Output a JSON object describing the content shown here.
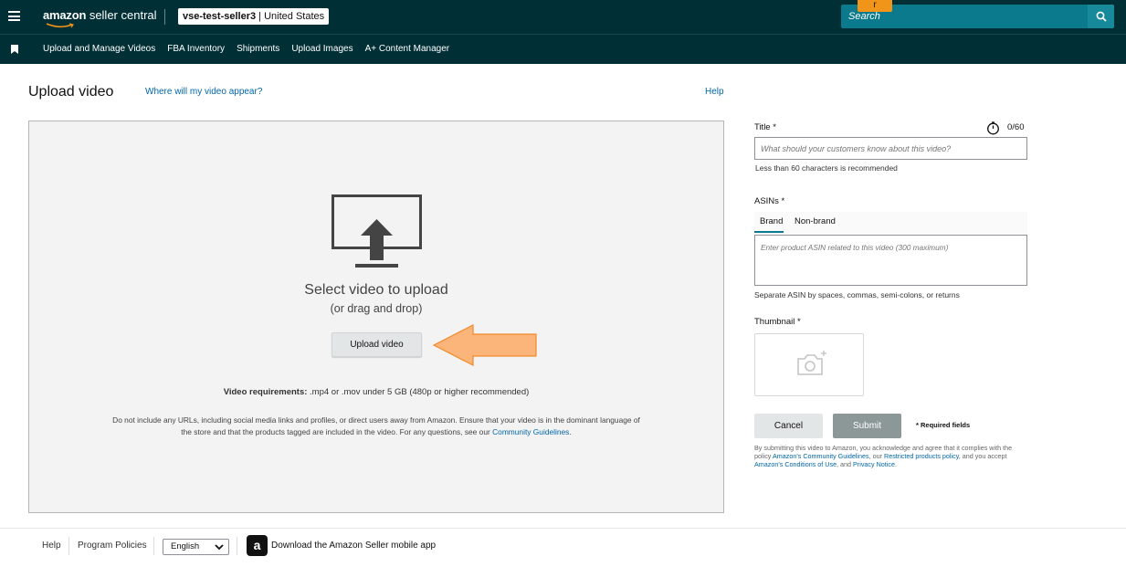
{
  "topbar": {
    "logo_brand": "amazon",
    "logo_suffix": " seller central",
    "account_name": "vse-test-seller3",
    "account_sep": " | ",
    "account_region": "United States",
    "search_text": "Search",
    "badge": "r"
  },
  "nav": {
    "items": [
      "Upload and Manage Videos",
      "FBA Inventory",
      "Shipments",
      "Upload Images",
      "A+ Content Manager"
    ]
  },
  "page": {
    "title": "Upload video",
    "where_link": "Where will my video appear?",
    "help_link": "Help"
  },
  "upload": {
    "select_title": "Select video to upload",
    "select_sub": "(or drag and drop)",
    "button_label": "Upload video",
    "req_label": "Video requirements:",
    "req_text": " .mp4 or .mov under 5 GB (480p or higher recommended)",
    "policy_text": "Do not include any URLs, including social media links and profiles, or direct users away from Amazon. Ensure that your video is in the dominant language of the store and that the products tagged are included in the video. For any questions, see our ",
    "policy_link": "Community Guidelines",
    "policy_end": "."
  },
  "form": {
    "title_label": "Title *",
    "char_count": "0/60",
    "title_placeholder": "What should your customers know about this video?",
    "title_hint": "Less than 60 characters is recommended",
    "asins_label": "ASINs *",
    "tab_brand": "Brand",
    "tab_nonbrand": "Non-brand",
    "asin_placeholder": "Enter product ASIN related to this video (300 maximum)",
    "asin_hint": "Separate ASIN by spaces, commas, semi-colons, or returns",
    "thumbnail_label": "Thumbnail *",
    "cancel_label": "Cancel",
    "submit_label": "Submit",
    "required_note": "* Required fields",
    "legal_1": "By submitting this video to Amazon, you acknowledge and agree that it complies with the policy ",
    "legal_link1": "Amazon's Community Guidelines",
    "legal_2": ", our ",
    "legal_link2": "Restricted products policy",
    "legal_3": ", and you accept ",
    "legal_link3": "Amazon's Conditions of Use",
    "legal_4": ", and ",
    "legal_link4": "Privacy Notice",
    "legal_5": "."
  },
  "footer": {
    "help": "Help",
    "program_policies": "Program Policies",
    "language": "English",
    "app_icon_letter": "a",
    "app_text": "Download the Amazon Seller mobile app"
  },
  "colors": {
    "topbar_bg": "#002f36",
    "search_bg": "#0b7a8d",
    "link": "#0066a8",
    "annotation_arrow": "#fbb57a"
  }
}
